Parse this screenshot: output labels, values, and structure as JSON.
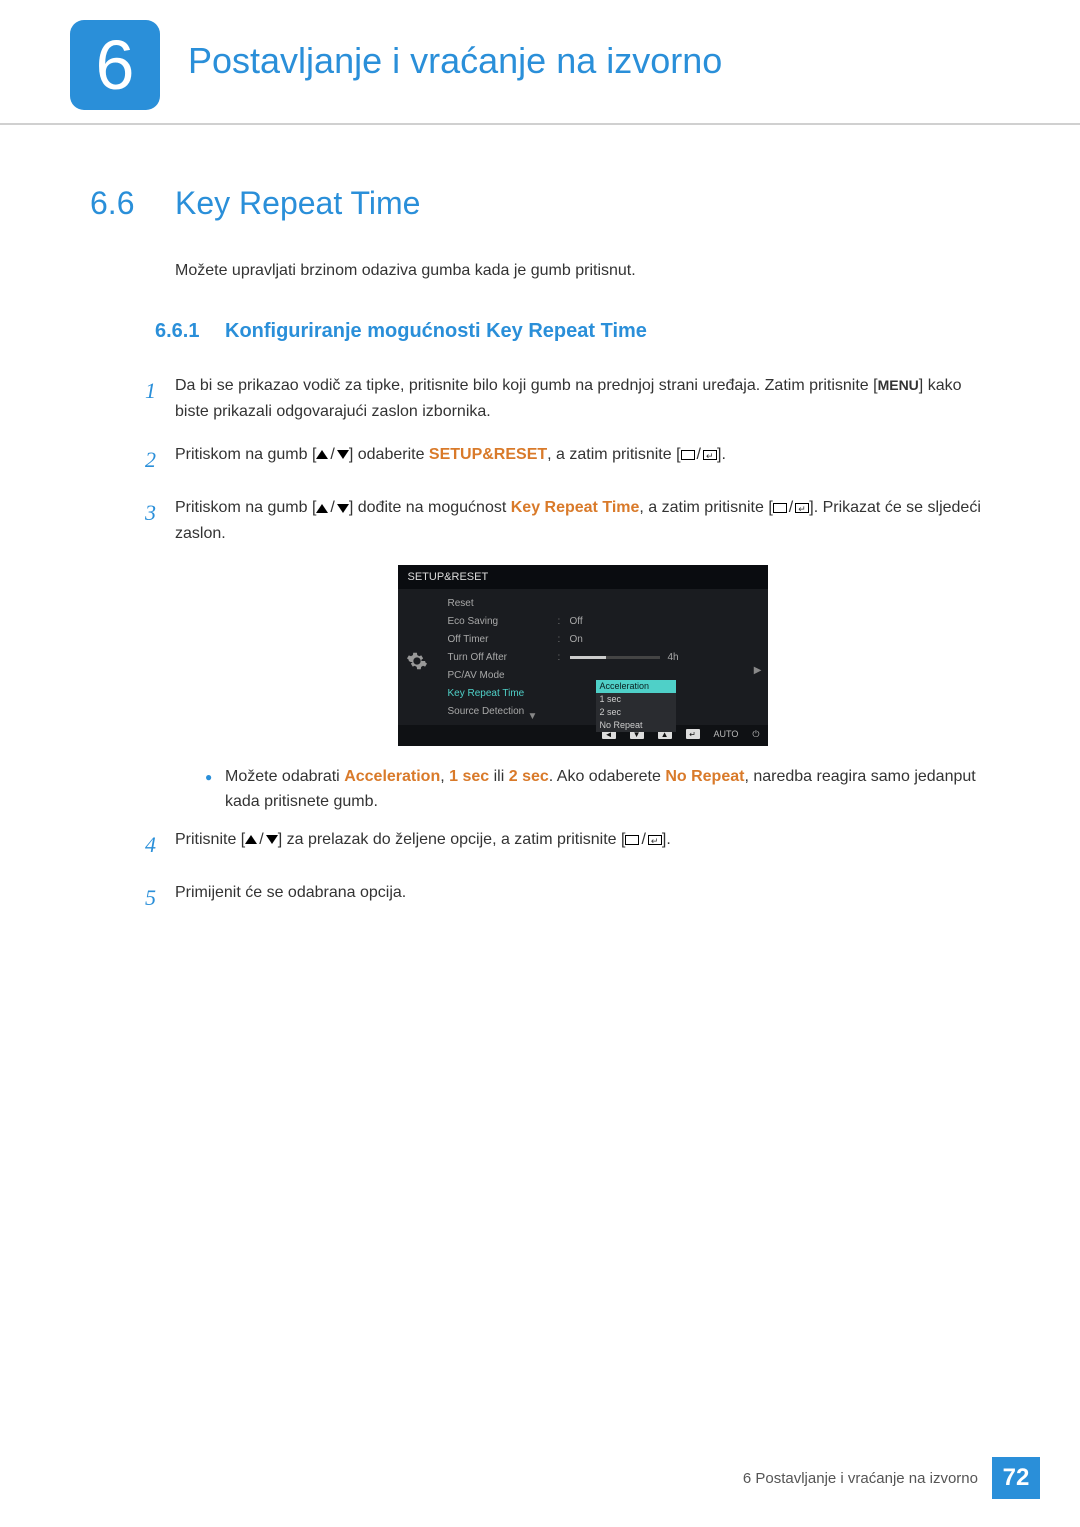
{
  "chapter": {
    "num": "6",
    "title": "Postavljanje i vraćanje na izvorno"
  },
  "section": {
    "num": "6.6",
    "title": "Key Repeat Time",
    "intro": "Možete upravljati brzinom odaziva gumba kada je gumb pritisnut."
  },
  "subsection": {
    "num": "6.6.1",
    "title": "Konfiguriranje mogućnosti Key Repeat Time"
  },
  "steps": {
    "s1a": "Da bi se prikazao vodič za tipke, pritisnite bilo koji gumb na prednjoj strani uređaja. Zatim pritisnite ",
    "s1b": " kako biste prikazali odgovarajući zaslon izbornika.",
    "menu_label": "MENU",
    "s2a": "Pritiskom na gumb ",
    "s2b": " odaberite ",
    "s2_target": "SETUP&RESET",
    "s2c": ", a zatim pritisnite ",
    "s2d": ".",
    "s3a": "Pritiskom na gumb ",
    "s3b": " dođite na mogućnost ",
    "s3_target": "Key Repeat Time",
    "s3c": ", a zatim pritisnite ",
    "s3d": ". Prikazat će se sljedeći zaslon.",
    "note_a": "Možete odabrati ",
    "note_acc": "Acceleration",
    "note_1s": "1 sec",
    "note_or": " ili ",
    "note_2s": "2 sec",
    "note_b": ". Ako odaberete ",
    "note_nr": "No Repeat",
    "note_c": ", naredba reagira samo jedanput kada pritisnete gumb.",
    "s4a": "Pritisnite ",
    "s4b": " za prelazak do željene opcije, a zatim pritisnite ",
    "s4c": ".",
    "s5": "Primijenit će se odabrana opcija.",
    "comma_sep": ", "
  },
  "osd": {
    "header": "SETUP&RESET",
    "rows": [
      {
        "label": "Reset",
        "val": ""
      },
      {
        "label": "Eco Saving",
        "val": "Off"
      },
      {
        "label": "Off Timer",
        "val": "On"
      },
      {
        "label": "Turn Off After",
        "val": "4h",
        "slider": true
      },
      {
        "label": "PC/AV Mode",
        "val": ""
      },
      {
        "label": "Key Repeat Time",
        "val": "",
        "selected": true
      },
      {
        "label": "Source Detection",
        "val": ""
      }
    ],
    "dropdown": [
      "Acceleration",
      "1 sec",
      "2 sec",
      "No Repeat"
    ],
    "footer_auto": "AUTO"
  },
  "footer": {
    "text": "6 Postavljanje i vraćanje na izvorno",
    "page": "72"
  }
}
